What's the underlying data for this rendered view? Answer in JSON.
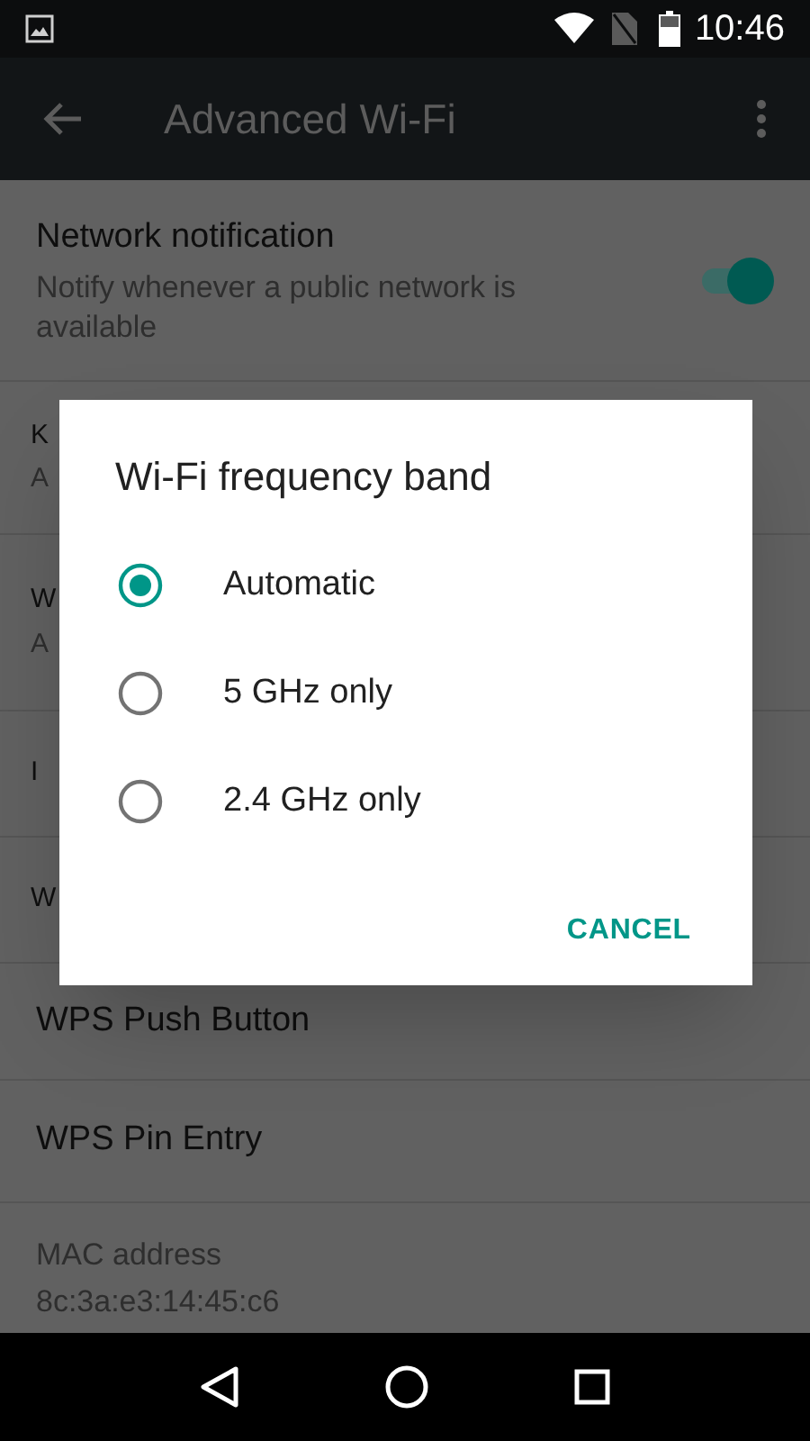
{
  "status_bar": {
    "time": "10:46"
  },
  "app_bar": {
    "title": "Advanced Wi-Fi"
  },
  "settings": [
    {
      "kind": "toggle",
      "title": "Network notification",
      "subtitle": "Notify whenever a public network is available",
      "on": true
    },
    {
      "kind": "clipped",
      "title": "K",
      "subtitle": "A"
    },
    {
      "kind": "clipped",
      "title": "W",
      "subtitle": "A"
    },
    {
      "kind": "clipped",
      "title": "I"
    },
    {
      "kind": "clipped",
      "title": "W"
    },
    {
      "kind": "text",
      "title": "WPS Push Button"
    },
    {
      "kind": "text",
      "title": "WPS Pin Entry"
    },
    {
      "kind": "info",
      "title": "MAC address",
      "subtitle": "8c:3a:e3:14:45:c6"
    }
  ],
  "dialog": {
    "title": "Wi-Fi frequency band",
    "options": [
      {
        "label": "Automatic",
        "selected": true
      },
      {
        "label": "5 GHz only",
        "selected": false
      },
      {
        "label": "2.4 GHz only",
        "selected": false
      }
    ],
    "buttons": [
      "CANCEL"
    ]
  }
}
